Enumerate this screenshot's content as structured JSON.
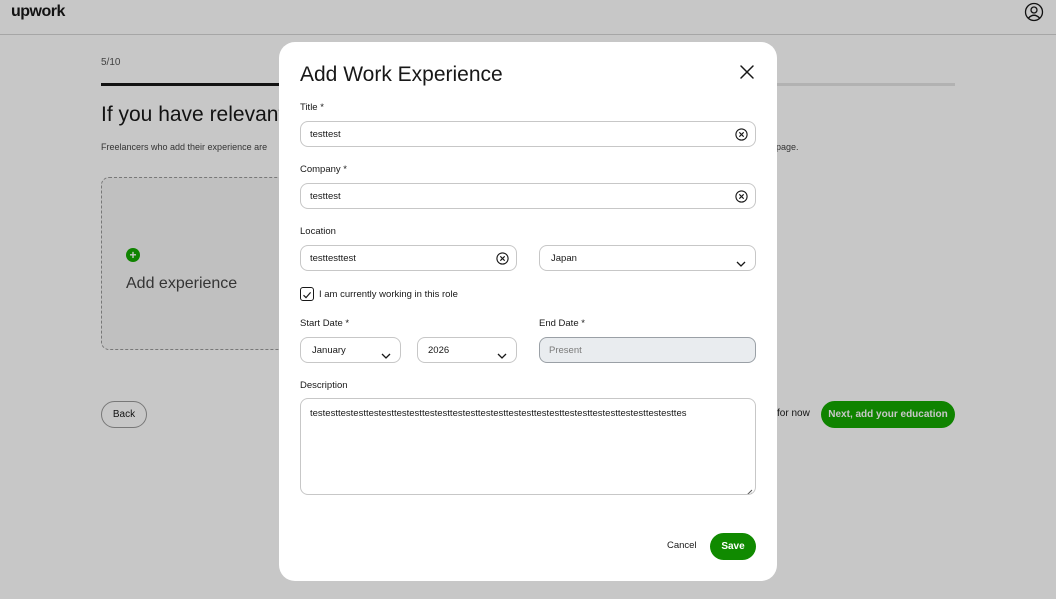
{
  "background": {
    "logo": "upwork",
    "step": "5/10",
    "progress_fraction": 0.5,
    "heading": "If you have relevant",
    "subtext": "Freelancers who add their experience are",
    "subtext_tail": "page.",
    "add_experience_label": "Add experience",
    "back_label": "Back",
    "skip_label": "for now",
    "next_label": "Next, add your education"
  },
  "modal": {
    "title": "Add Work Experience",
    "title_field": {
      "label": "Title *",
      "value": "testtest"
    },
    "company_field": {
      "label": "Company *",
      "value": "testtest"
    },
    "location_field": {
      "label": "Location",
      "value": "testtesttest",
      "country": "Japan"
    },
    "current_role": {
      "label": "I am currently working in this role",
      "checked": true
    },
    "start_date": {
      "label": "Start Date *",
      "month": "January",
      "year": "2026"
    },
    "end_date": {
      "label": "End Date *",
      "placeholder": "Present"
    },
    "description": {
      "label": "Description",
      "value": "testesttestesttestesttestesttestesttestesttestesttestesttestesttestesttestesttestesttestesttes"
    },
    "cancel_label": "Cancel",
    "save_label": "Save"
  },
  "colors": {
    "brand_green": "#14a800",
    "save_green": "#108a00",
    "overlay": "rgba(0,0,0,0.22)"
  },
  "icons": [
    "user-icon",
    "plus-icon",
    "close-icon",
    "clear-icon",
    "chevron-down-icon",
    "check-icon",
    "resize-handle-icon"
  ]
}
